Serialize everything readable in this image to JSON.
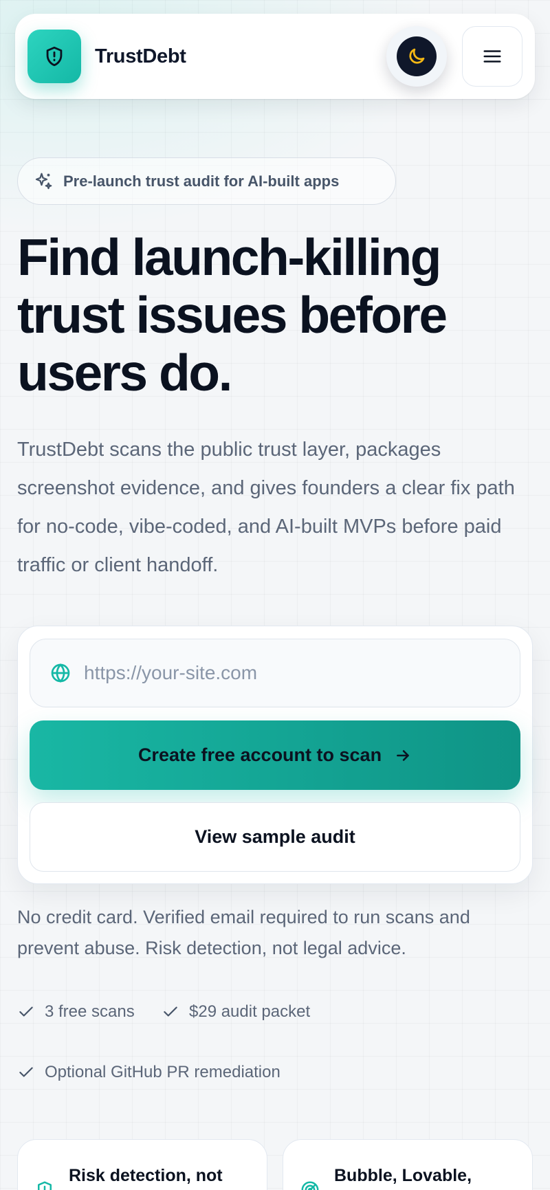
{
  "header": {
    "brand": "TrustDebt",
    "logo_icon": "shield-alert-icon",
    "theme_icon": "moon-icon",
    "menu_icon": "hamburger-menu-icon"
  },
  "hero": {
    "badge_icon": "sparkles-icon",
    "badge_text": "Pre-launch trust audit for AI-built apps",
    "headline": "Find launch-killing trust issues before users do.",
    "lead": "TrustDebt scans the public trust layer, packages screenshot evidence, and gives founders a clear fix path for no-code, vibe-coded, and AI-built MVPs before paid traffic or client handoff."
  },
  "scan_form": {
    "url_icon": "globe-icon",
    "url_value": "",
    "url_placeholder": "https://your-site.com",
    "primary_label": "Create free account to scan",
    "primary_icon": "arrow-right-icon",
    "secondary_label": "View sample audit"
  },
  "fineprint": "No credit card. Verified email required to run scans and prevent abuse. Risk detection, not legal advice.",
  "checks": [
    "3 free scans",
    "$29 audit packet",
    "Optional GitHub PR remediation"
  ],
  "features": [
    {
      "icon": "shield-alert-icon",
      "label": "Risk detection, not legal advice"
    },
    {
      "icon": "radar-icon",
      "label": "Bubble, Lovable, Replit, Cursor"
    }
  ],
  "colors": {
    "accent": "#14b8a6",
    "accent_dark": "#0f9486",
    "text_primary": "#0b1220",
    "text_muted": "#5b6678",
    "moon": "#f5b814"
  }
}
